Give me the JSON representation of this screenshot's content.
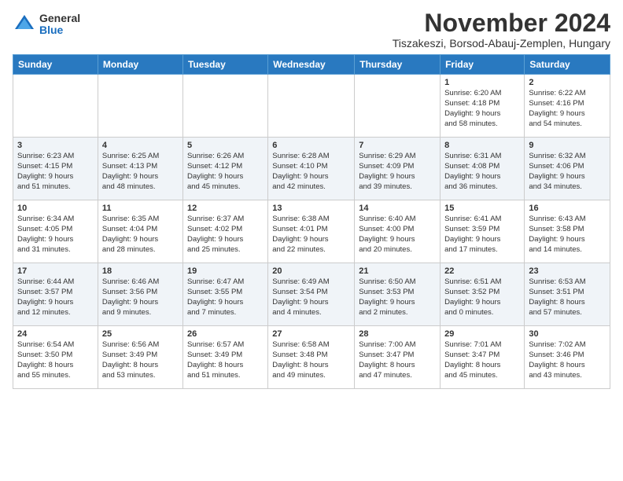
{
  "header": {
    "logo_general": "General",
    "logo_blue": "Blue",
    "month_title": "November 2024",
    "subtitle": "Tiszakeszi, Borsod-Abauj-Zemplen, Hungary"
  },
  "weekdays": [
    "Sunday",
    "Monday",
    "Tuesday",
    "Wednesday",
    "Thursday",
    "Friday",
    "Saturday"
  ],
  "weeks": [
    [
      {
        "day": "",
        "info": ""
      },
      {
        "day": "",
        "info": ""
      },
      {
        "day": "",
        "info": ""
      },
      {
        "day": "",
        "info": ""
      },
      {
        "day": "",
        "info": ""
      },
      {
        "day": "1",
        "info": "Sunrise: 6:20 AM\nSunset: 4:18 PM\nDaylight: 9 hours\nand 58 minutes."
      },
      {
        "day": "2",
        "info": "Sunrise: 6:22 AM\nSunset: 4:16 PM\nDaylight: 9 hours\nand 54 minutes."
      }
    ],
    [
      {
        "day": "3",
        "info": "Sunrise: 6:23 AM\nSunset: 4:15 PM\nDaylight: 9 hours\nand 51 minutes."
      },
      {
        "day": "4",
        "info": "Sunrise: 6:25 AM\nSunset: 4:13 PM\nDaylight: 9 hours\nand 48 minutes."
      },
      {
        "day": "5",
        "info": "Sunrise: 6:26 AM\nSunset: 4:12 PM\nDaylight: 9 hours\nand 45 minutes."
      },
      {
        "day": "6",
        "info": "Sunrise: 6:28 AM\nSunset: 4:10 PM\nDaylight: 9 hours\nand 42 minutes."
      },
      {
        "day": "7",
        "info": "Sunrise: 6:29 AM\nSunset: 4:09 PM\nDaylight: 9 hours\nand 39 minutes."
      },
      {
        "day": "8",
        "info": "Sunrise: 6:31 AM\nSunset: 4:08 PM\nDaylight: 9 hours\nand 36 minutes."
      },
      {
        "day": "9",
        "info": "Sunrise: 6:32 AM\nSunset: 4:06 PM\nDaylight: 9 hours\nand 34 minutes."
      }
    ],
    [
      {
        "day": "10",
        "info": "Sunrise: 6:34 AM\nSunset: 4:05 PM\nDaylight: 9 hours\nand 31 minutes."
      },
      {
        "day": "11",
        "info": "Sunrise: 6:35 AM\nSunset: 4:04 PM\nDaylight: 9 hours\nand 28 minutes."
      },
      {
        "day": "12",
        "info": "Sunrise: 6:37 AM\nSunset: 4:02 PM\nDaylight: 9 hours\nand 25 minutes."
      },
      {
        "day": "13",
        "info": "Sunrise: 6:38 AM\nSunset: 4:01 PM\nDaylight: 9 hours\nand 22 minutes."
      },
      {
        "day": "14",
        "info": "Sunrise: 6:40 AM\nSunset: 4:00 PM\nDaylight: 9 hours\nand 20 minutes."
      },
      {
        "day": "15",
        "info": "Sunrise: 6:41 AM\nSunset: 3:59 PM\nDaylight: 9 hours\nand 17 minutes."
      },
      {
        "day": "16",
        "info": "Sunrise: 6:43 AM\nSunset: 3:58 PM\nDaylight: 9 hours\nand 14 minutes."
      }
    ],
    [
      {
        "day": "17",
        "info": "Sunrise: 6:44 AM\nSunset: 3:57 PM\nDaylight: 9 hours\nand 12 minutes."
      },
      {
        "day": "18",
        "info": "Sunrise: 6:46 AM\nSunset: 3:56 PM\nDaylight: 9 hours\nand 9 minutes."
      },
      {
        "day": "19",
        "info": "Sunrise: 6:47 AM\nSunset: 3:55 PM\nDaylight: 9 hours\nand 7 minutes."
      },
      {
        "day": "20",
        "info": "Sunrise: 6:49 AM\nSunset: 3:54 PM\nDaylight: 9 hours\nand 4 minutes."
      },
      {
        "day": "21",
        "info": "Sunrise: 6:50 AM\nSunset: 3:53 PM\nDaylight: 9 hours\nand 2 minutes."
      },
      {
        "day": "22",
        "info": "Sunrise: 6:51 AM\nSunset: 3:52 PM\nDaylight: 9 hours\nand 0 minutes."
      },
      {
        "day": "23",
        "info": "Sunrise: 6:53 AM\nSunset: 3:51 PM\nDaylight: 8 hours\nand 57 minutes."
      }
    ],
    [
      {
        "day": "24",
        "info": "Sunrise: 6:54 AM\nSunset: 3:50 PM\nDaylight: 8 hours\nand 55 minutes."
      },
      {
        "day": "25",
        "info": "Sunrise: 6:56 AM\nSunset: 3:49 PM\nDaylight: 8 hours\nand 53 minutes."
      },
      {
        "day": "26",
        "info": "Sunrise: 6:57 AM\nSunset: 3:49 PM\nDaylight: 8 hours\nand 51 minutes."
      },
      {
        "day": "27",
        "info": "Sunrise: 6:58 AM\nSunset: 3:48 PM\nDaylight: 8 hours\nand 49 minutes."
      },
      {
        "day": "28",
        "info": "Sunrise: 7:00 AM\nSunset: 3:47 PM\nDaylight: 8 hours\nand 47 minutes."
      },
      {
        "day": "29",
        "info": "Sunrise: 7:01 AM\nSunset: 3:47 PM\nDaylight: 8 hours\nand 45 minutes."
      },
      {
        "day": "30",
        "info": "Sunrise: 7:02 AM\nSunset: 3:46 PM\nDaylight: 8 hours\nand 43 minutes."
      }
    ]
  ]
}
